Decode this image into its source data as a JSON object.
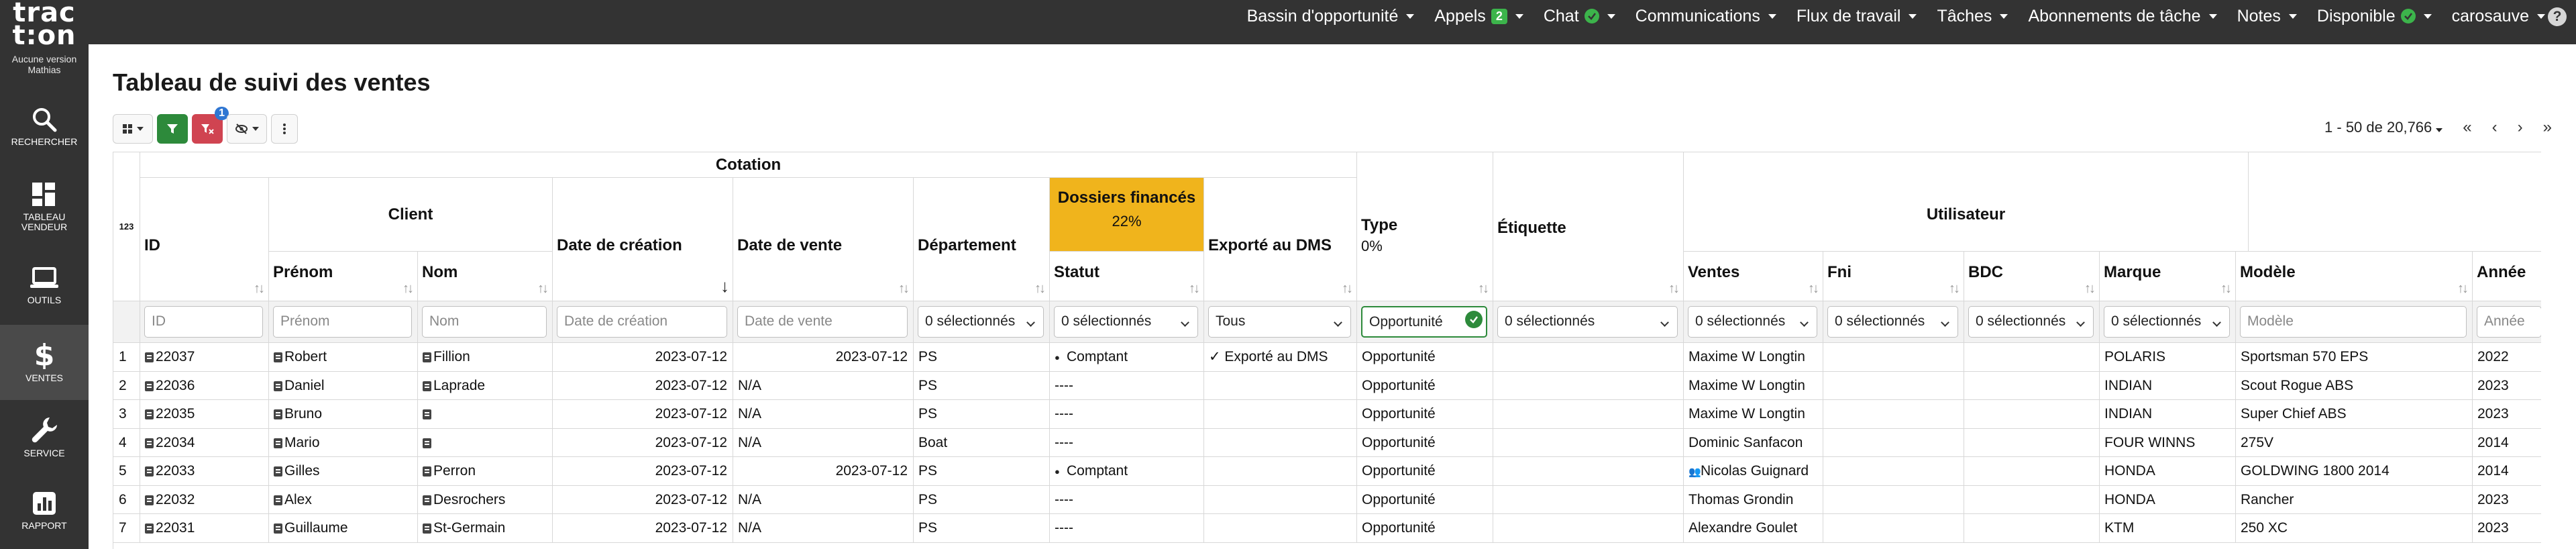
{
  "app": {
    "logo_line1": "trac",
    "logo_line2": "t:on",
    "version_line1": "Aucune version",
    "version_line2": "Mathias"
  },
  "sidebar": {
    "items": [
      {
        "label": "RECHERCHER",
        "icon": "search-icon"
      },
      {
        "label_line1": "TABLEAU",
        "label_line2": "VENDEUR",
        "icon": "dashboard-icon"
      },
      {
        "label": "OUTILS",
        "icon": "laptop-icon"
      },
      {
        "label": "VENTES",
        "icon": "dollar-icon"
      },
      {
        "label": "SERVICE",
        "icon": "wrench-icon"
      },
      {
        "label": "RAPPORT",
        "icon": "report-icon"
      }
    ]
  },
  "topmenu": {
    "items": [
      "Bassin d'opportunité",
      "Appels",
      "Chat",
      "Communications",
      "Flux de travail",
      "Tâches",
      "Abonnements de tâche",
      "Notes",
      "Disponible",
      "carosauve"
    ],
    "appels_badge": "2",
    "help": "?"
  },
  "page": {
    "title": "Tableau de suivi des ventes"
  },
  "toolbar": {
    "filter_badge": "1"
  },
  "pager": {
    "range": "1 - 50 de 20,766",
    "first": "«",
    "prev": "‹",
    "next": "›",
    "last": "»"
  },
  "table": {
    "index_header": "123",
    "groups": {
      "cotation": "Cotation",
      "client": "Client",
      "utilisateur": "Utilisateur"
    },
    "columns": {
      "id": "ID",
      "prenom": "Prénom",
      "nom": "Nom",
      "date_creation": "Date de création",
      "date_vente": "Date de vente",
      "departement": "Département",
      "dossiers_finances": "Dossiers financés",
      "dossiers_pct": "22%",
      "statut": "Statut",
      "exporte": "Exporté au DMS",
      "type": "Type",
      "type_pct": "0%",
      "etiquette": "Étiquette",
      "ventes": "Ventes",
      "fni": "Fni",
      "bdc": "BDC",
      "marque": "Marque",
      "modele": "Modèle",
      "annee": "Année"
    },
    "filters": {
      "id": "ID",
      "prenom": "Prénom",
      "nom": "Nom",
      "date_creation": "Date de création",
      "date_vente": "Date de vente",
      "departement": "0 sélectionnés",
      "statut": "0 sélectionnés",
      "exporte": "Tous",
      "type": "Opportunité",
      "etiquette": "0 sélectionnés",
      "ventes": "0 sélectionnés",
      "fni": "0 sélectionnés",
      "bdc": "0 sélectionnés",
      "marque": "0 sélectionnés",
      "modele": "Modèle",
      "annee": "Année"
    },
    "rows": [
      {
        "n": "1",
        "id": "22037",
        "prenom": "Robert",
        "nom": "Fillion",
        "date_creation": "2023-07-12",
        "date_vente": "2023-07-12",
        "departement": "PS",
        "statut": "Comptant",
        "exporte": "✓ Exporté au DMS",
        "type": "Opportunité",
        "etiquette": "",
        "ventes": "Maxime W Longtin",
        "fni": "",
        "bdc": "",
        "marque": "POLARIS",
        "modele": "Sportsman 570 EPS",
        "annee": "2022"
      },
      {
        "n": "2",
        "id": "22036",
        "prenom": "Daniel",
        "nom": "Laprade",
        "date_creation": "2023-07-12",
        "date_vente": "N/A",
        "departement": "PS",
        "statut": "----",
        "exporte": "",
        "type": "Opportunité",
        "etiquette": "",
        "ventes": "Maxime W Longtin",
        "fni": "",
        "bdc": "",
        "marque": "INDIAN",
        "modele": "Scout Rogue ABS",
        "annee": "2023"
      },
      {
        "n": "3",
        "id": "22035",
        "prenom": "Bruno",
        "nom": "",
        "date_creation": "2023-07-12",
        "date_vente": "N/A",
        "departement": "PS",
        "statut": "----",
        "exporte": "",
        "type": "Opportunité",
        "etiquette": "",
        "ventes": "Maxime W Longtin",
        "fni": "",
        "bdc": "",
        "marque": "INDIAN",
        "modele": "Super Chief ABS",
        "annee": "2023"
      },
      {
        "n": "4",
        "id": "22034",
        "prenom": "Mario",
        "nom": "",
        "date_creation": "2023-07-12",
        "date_vente": "N/A",
        "departement": "Boat",
        "statut": "----",
        "exporte": "",
        "type": "Opportunité",
        "etiquette": "",
        "ventes": "Dominic Sanfacon",
        "fni": "",
        "bdc": "",
        "marque": "FOUR WINNS",
        "modele": "275V",
        "annee": "2014"
      },
      {
        "n": "5",
        "id": "22033",
        "prenom": "Gilles",
        "nom": "Perron",
        "date_creation": "2023-07-12",
        "date_vente": "2023-07-12",
        "departement": "PS",
        "statut": "Comptant",
        "exporte": "",
        "type": "Opportunité",
        "etiquette": "",
        "ventes": "Nicolas Guignard",
        "fni": "",
        "bdc": "",
        "marque": "HONDA",
        "modele": "GOLDWING 1800 2014",
        "annee": "2014"
      },
      {
        "n": "6",
        "id": "22032",
        "prenom": "Alex",
        "nom": "Desrochers",
        "date_creation": "2023-07-12",
        "date_vente": "N/A",
        "departement": "PS",
        "statut": "----",
        "exporte": "",
        "type": "Opportunité",
        "etiquette": "",
        "ventes": "Thomas Grondin",
        "fni": "",
        "bdc": "",
        "marque": "HONDA",
        "modele": "Rancher",
        "annee": "2023"
      },
      {
        "n": "7",
        "id": "22031",
        "prenom": "Guillaume",
        "nom": "St-Germain",
        "date_creation": "2023-07-12",
        "date_vente": "N/A",
        "departement": "PS",
        "statut": "----",
        "exporte": "",
        "type": "Opportunité",
        "etiquette": "",
        "ventes": "Alexandre Goulet",
        "fni": "",
        "bdc": "",
        "marque": "KTM",
        "modele": "250 XC",
        "annee": "2023"
      }
    ]
  },
  "colors": {
    "dark_bar": "#333333",
    "accent_green": "#2d8a3b",
    "accent_red": "#d04451",
    "highlight_yellow": "#f0b41c",
    "badge_blue": "#2f76d2"
  }
}
